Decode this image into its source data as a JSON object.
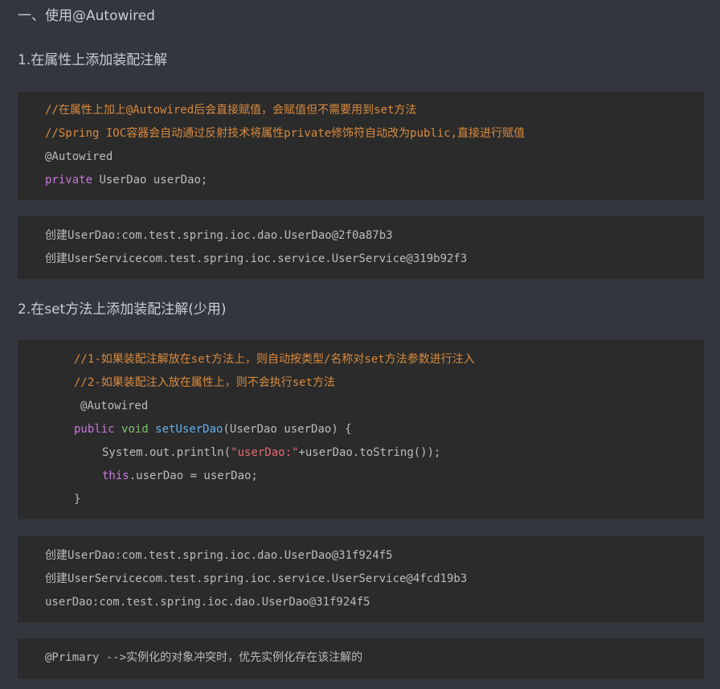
{
  "headings": {
    "h1": "一、使用@Autowired",
    "h2": "1.在属性上添加装配注解",
    "h3": "2.在set方法上添加装配注解(少用)"
  },
  "block1": {
    "comment1": "//在属性上加上@Autowired后会直接赋值，会赋值但不需要用到set方法",
    "comment2": "//Spring IOC容器会自动通过反射技术将属性private修饰符自动改为public,直接进行赋值",
    "annotation": "@Autowired",
    "kw_private": "private",
    "field_decl": " UserDao userDao;"
  },
  "output1": {
    "line1": "创建UserDao:com.test.spring.ioc.dao.UserDao@2f0a87b3",
    "line2": "创建UserServicecom.test.spring.ioc.service.UserService@319b92f3"
  },
  "block2": {
    "comment1": "//1-如果装配注解放在set方法上，则自动按类型/名称对set方法参数进行注入",
    "comment2": "//2-如果装配注入放在属性上，则不会执行set方法",
    "annotation": "@Autowired",
    "kw_public": "public",
    "kw_void": "void",
    "method_name": "setUserDao",
    "method_params": "(UserDao userDao) {",
    "println_prefix": "System.out.println(",
    "println_string": "\"userDao:\"",
    "println_suffix": "+userDao.toString());",
    "kw_this": "this",
    "assign": ".userDao = userDao;",
    "close_brace": "}"
  },
  "output2": {
    "line1": "创建UserDao:com.test.spring.ioc.dao.UserDao@31f924f5",
    "line2": "创建UserServicecom.test.spring.ioc.service.UserService@4fcd19b3",
    "line3": "userDao:com.test.spring.ioc.dao.UserDao@31f924f5"
  },
  "block3": {
    "line1": "@Primary -->实例化的对象冲突时，优先实例化存在该注解的"
  },
  "colors": {
    "page_bg": "#33373d",
    "code_bg": "#2b2b2b",
    "comment": "#d98a3e",
    "keyword": "#c678dd",
    "type_keyword": "#7ec16e",
    "function": "#61afef",
    "string": "#e06c75",
    "code_text": "#b9bcbf"
  }
}
